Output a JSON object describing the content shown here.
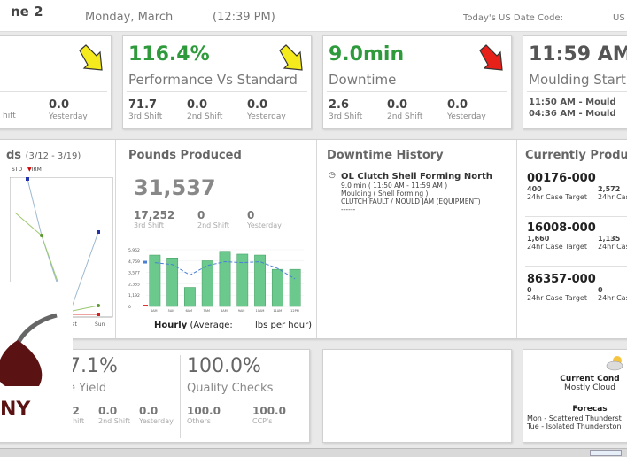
{
  "header": {
    "line": "ne 2",
    "date": "Monday, March",
    "time": "(12:39 PM)",
    "date_code_label": "Today's US Date Code:",
    "date_code_value": "US"
  },
  "kpi1": {
    "stats": [
      {
        "value": "",
        "label": "hift"
      },
      {
        "value": "0.0",
        "label": "Yesterday"
      }
    ]
  },
  "kpi2": {
    "value": "116.4%",
    "label": "Performance Vs Standard",
    "stats": [
      {
        "value": "71.7",
        "label": "3rd Shift"
      },
      {
        "value": "0.0",
        "label": "2nd Shift"
      },
      {
        "value": "0.0",
        "label": "Yesterday"
      }
    ]
  },
  "kpi3": {
    "value": "9.0min",
    "label": "Downtime",
    "stats": [
      {
        "value": "2.6",
        "label": "3rd Shift"
      },
      {
        "value": "0.0",
        "label": "2nd Shift"
      },
      {
        "value": "0.0",
        "label": "Yesterday"
      }
    ]
  },
  "kpi4": {
    "value": "11:59 AM",
    "label": "Moulding Start",
    "lines": [
      "11:50 AM - Mould",
      "04:36 AM - Mould"
    ]
  },
  "yieldchart": {
    "title": "ds",
    "range": "(3/12 - 3/19)",
    "legend1": "STD",
    "legend2": "IRM",
    "x_labels": [
      "Sat",
      "Sun"
    ]
  },
  "pounds": {
    "title": "Pounds Produced",
    "total": "31,537",
    "stats": [
      {
        "value": "17,252",
        "label": "3rd Shift"
      },
      {
        "value": "0",
        "label": "2nd Shift"
      },
      {
        "value": "0",
        "label": "Yesterday"
      }
    ],
    "hourly_label": "Hourly",
    "avg_label": "(Average:",
    "unit_label": "lbs per hour)"
  },
  "downtime": {
    "title": "Downtime History",
    "item": {
      "title": "OL Clutch Shell Forming North",
      "duration": "9.0 min ( 11:50 AM - 11:59 AM )",
      "area": "Moulding ( Shell Forming )",
      "reason": "CLUTCH FAULT / MOULD JAM (EQUIPMENT)",
      "sep": "------"
    }
  },
  "current": {
    "title": "Currently Produ",
    "items": [
      {
        "code": "00176-000",
        "v1": "400",
        "v2": "2,572",
        "l1": "24hr Case Target",
        "l2": "24hr Cas"
      },
      {
        "code": "16008-000",
        "v1": "1,660",
        "v2": "1,135",
        "l1": "24hr Case Target",
        "l2": "24hr Cas"
      },
      {
        "code": "86357-000",
        "v1": "0",
        "v2": "0",
        "l1": "24hr Case Target",
        "l2": "24hr Cas"
      }
    ]
  },
  "bottom1": {
    "value": "7.1%",
    "label": "e Yield",
    "stats": [
      {
        "value": ".2",
        "label": "Shift"
      },
      {
        "value": "0.0",
        "label": "2nd Shift"
      },
      {
        "value": "0.0",
        "label": "Yesterday"
      }
    ]
  },
  "bottom2": {
    "value": "100.0%",
    "label": "Quality Checks",
    "stats": [
      {
        "value": "100.0",
        "label": "Others"
      },
      {
        "value": "100.0",
        "label": "CCP's"
      }
    ]
  },
  "weather": {
    "current_label": "Current Cond",
    "current_text": "Mostly Cloud",
    "forecast_label": "Forecas",
    "forecast": [
      "Mon - Scattered Thunderst",
      "Tue - Isolated Thunderston"
    ]
  },
  "logo_text": "NY",
  "chart_data": {
    "type": "bar",
    "title": "Hourly",
    "categories": [
      "4AM",
      "5AM",
      "6AM",
      "7AM",
      "8AM",
      "9AM",
      "10AM",
      "11AM",
      "12PM"
    ],
    "values": [
      5400,
      5100,
      2000,
      4800,
      5800,
      5500,
      5400,
      3900,
      3900
    ],
    "average_line": [
      4600,
      4400,
      3300,
      4300,
      4700,
      4600,
      4700,
      4000,
      2900
    ],
    "y_ticks": [
      "5,962",
      "4,769",
      "3,577",
      "2,385",
      "1,192",
      "0"
    ],
    "ylim": [
      0,
      5962
    ],
    "bar_color": "#6cc98e",
    "avg_color": "#4a7fd6"
  }
}
